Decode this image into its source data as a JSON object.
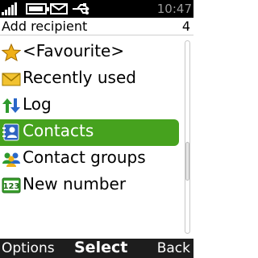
{
  "status": {
    "time": "10:47"
  },
  "title": {
    "text": "Add recipient",
    "count": "4"
  },
  "items": [
    {
      "label": "<Favourite>",
      "icon": "star-icon"
    },
    {
      "label": "Recently used",
      "icon": "envelope-icon"
    },
    {
      "label": "Log",
      "icon": "log-arrows-icon"
    },
    {
      "label": "Contacts",
      "icon": "contacts-icon",
      "selected": true
    },
    {
      "label": "Contact groups",
      "icon": "contact-groups-icon"
    },
    {
      "label": "New number",
      "icon": "keypad-123-icon"
    }
  ],
  "softkeys": {
    "left": "Options",
    "middle": "Select",
    "right": "Back"
  },
  "colors": {
    "highlight": "#46a21e",
    "softkey_bar": "#1d1d1d"
  }
}
